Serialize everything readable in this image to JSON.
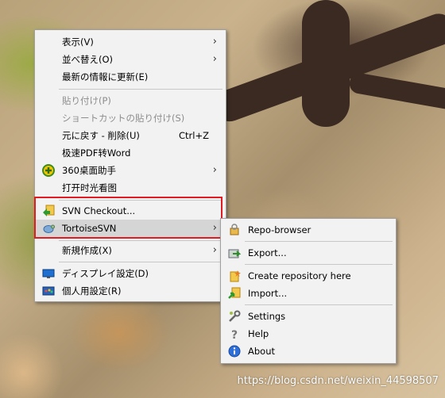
{
  "main_menu": {
    "items": [
      {
        "label": "表示(V)",
        "shortcut": "",
        "submenu": true
      },
      {
        "label": "並べ替え(O)",
        "shortcut": "",
        "submenu": true
      },
      {
        "label": "最新の情報に更新(E)",
        "shortcut": "",
        "submenu": false
      },
      {
        "label": "貼り付け(P)",
        "shortcut": "",
        "submenu": false,
        "disabled": true
      },
      {
        "label": "ショートカットの貼り付け(S)",
        "shortcut": "",
        "submenu": false,
        "disabled": true
      },
      {
        "label": "元に戻す - 削除(U)",
        "shortcut": "Ctrl+Z",
        "submenu": false
      },
      {
        "label": "极速PDF转Word",
        "shortcut": "",
        "submenu": false
      },
      {
        "label": "360桌面助手",
        "shortcut": "",
        "submenu": true,
        "icon": "360-icon"
      },
      {
        "label": "打开时光看图",
        "shortcut": "",
        "submenu": false
      },
      {
        "label": "SVN Checkout...",
        "shortcut": "",
        "submenu": false,
        "icon": "svn-checkout-icon"
      },
      {
        "label": "TortoiseSVN",
        "shortcut": "",
        "submenu": true,
        "icon": "tortoisesvn-icon",
        "highlighted": true
      },
      {
        "label": "新規作成(X)",
        "shortcut": "",
        "submenu": true
      },
      {
        "label": "ディスプレイ設定(D)",
        "shortcut": "",
        "submenu": false,
        "icon": "display-icon"
      },
      {
        "label": "個人用設定(R)",
        "shortcut": "",
        "submenu": false,
        "icon": "personalize-icon"
      }
    ],
    "arrow": "›"
  },
  "sub_menu": {
    "items": [
      {
        "label": "Repo-browser",
        "icon": "repo-browser-icon"
      },
      {
        "label": "Export...",
        "icon": "export-icon"
      },
      {
        "label": "Create repository here",
        "icon": "create-repo-icon"
      },
      {
        "label": "Import...",
        "icon": "import-icon"
      },
      {
        "label": "Settings",
        "icon": "settings-icon"
      },
      {
        "label": "Help",
        "icon": "help-icon"
      },
      {
        "label": "About",
        "icon": "about-icon"
      }
    ]
  },
  "watermark": "https://blog.csdn.net/weixin_44598507",
  "colors": {
    "highlight_box": "#e21b23",
    "menu_bg": "#f2f2f2",
    "hover_bg": "#d5d5d5"
  }
}
